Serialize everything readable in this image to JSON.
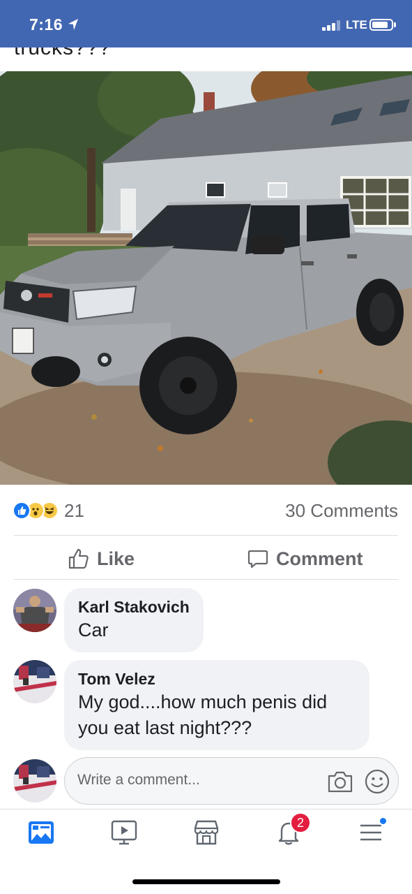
{
  "status_bar": {
    "time": "7:16",
    "network": "LTE",
    "battery_level": 0.85,
    "signal_bars": 3
  },
  "post": {
    "caption_partial": "trucks???",
    "photo_icon": "pickup-truck-photo",
    "reaction_count": "21",
    "comments_count": "30 Comments",
    "reaction_icons": [
      "like-icon",
      "wow-icon",
      "haha-icon"
    ]
  },
  "actions": {
    "like_label": "Like",
    "comment_label": "Comment"
  },
  "comments": [
    {
      "name": "Karl Stakovich",
      "text": "Car"
    },
    {
      "name": "Tom Velez",
      "text": "My god....how much penis did you eat last night???"
    }
  ],
  "write_comment": {
    "placeholder": "Write a comment..."
  },
  "bottom_nav": {
    "items": [
      "news-feed-icon",
      "watch-icon",
      "marketplace-icon",
      "notifications-icon",
      "menu-icon"
    ],
    "notifications_badge": "2"
  },
  "colors": {
    "brand": "#4267b2",
    "like_blue": "#1877f2",
    "badge_red": "#e41e3f",
    "bubble": "#f0f2f5"
  }
}
